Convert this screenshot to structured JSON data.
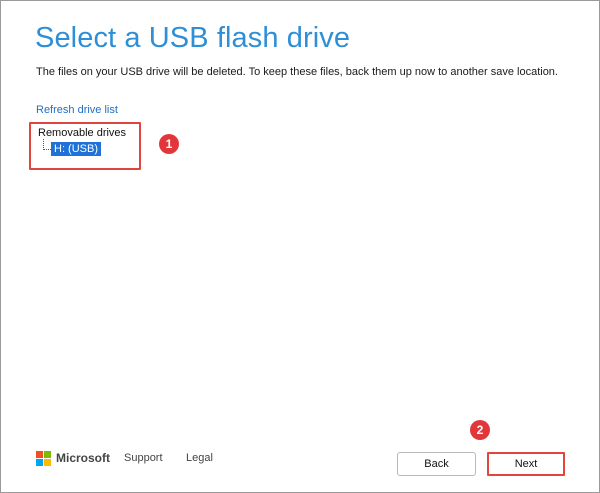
{
  "page": {
    "title": "Select a USB flash drive",
    "subtitle": "The files on your USB drive will be deleted. To keep these files, back them up now to another save location."
  },
  "drives": {
    "refresh_label": "Refresh drive list",
    "group_label": "Removable drives",
    "items": [
      {
        "label": "H: (USB)",
        "selected": true
      }
    ]
  },
  "annotations": {
    "step1": "1",
    "step2": "2",
    "color": "#e2373a"
  },
  "footer": {
    "brand": "Microsoft",
    "support_label": "Support",
    "legal_label": "Legal",
    "back_label": "Back",
    "next_label": "Next"
  },
  "colors": {
    "title": "#2f8fd6",
    "selection": "#1e72d8",
    "highlight_border": "#e0463f"
  }
}
